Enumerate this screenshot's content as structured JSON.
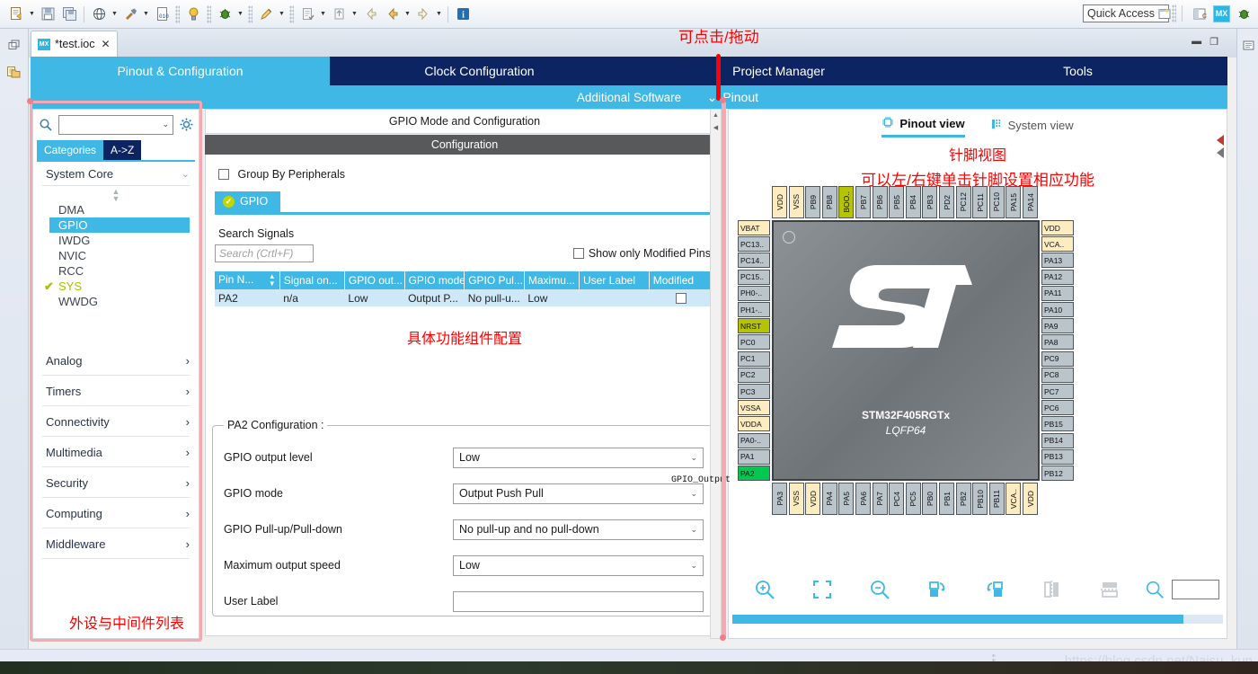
{
  "toolbar": {
    "quick_access_label": "Quick Access",
    "icons": [
      "new-file-icon",
      "save-icon",
      "save-all-icon",
      "globe-icon",
      "build-hammer-icon",
      "binary-file-icon",
      "debug-bulb-icon",
      "debug-bug-icon",
      "pen-icon",
      "marker-icon",
      "export-icon",
      "back-icon",
      "forward-icon",
      "info-icon"
    ],
    "right_icons": [
      "perspective-add-icon",
      "c-perspective-icon",
      "mx-perspective-icon",
      "debug-perspective-icon"
    ],
    "mx_badge": "MX"
  },
  "editor": {
    "tab_title": "*test.ioc",
    "tab_icon_label": "MX",
    "close_glyph": "✕"
  },
  "cube_tabs": [
    {
      "label": "Pinout & Configuration",
      "active": true
    },
    {
      "label": "Clock Configuration",
      "active": false
    },
    {
      "label": "Project Manager",
      "active": false
    },
    {
      "label": "Tools",
      "active": false
    }
  ],
  "subbar": {
    "additional_software": "Additional Software",
    "pinout": "Pinout",
    "pinout_chevron": "⌄"
  },
  "sidebar": {
    "search_placeholder": "",
    "search_value": "",
    "gear_icon": "gear-icon",
    "mode_tabs": [
      {
        "label": "Categories",
        "active": true
      },
      {
        "label": "A->Z",
        "active": false
      }
    ],
    "groups": [
      {
        "label": "System Core",
        "expanded": true,
        "items": [
          {
            "label": "DMA",
            "selected": false,
            "checked": false
          },
          {
            "label": "GPIO",
            "selected": true,
            "checked": false
          },
          {
            "label": "IWDG",
            "selected": false,
            "checked": false
          },
          {
            "label": "NVIC",
            "selected": false,
            "checked": false
          },
          {
            "label": "RCC",
            "selected": false,
            "checked": false
          },
          {
            "label": "SYS",
            "selected": false,
            "checked": true
          },
          {
            "label": "WWDG",
            "selected": false,
            "checked": false
          }
        ]
      },
      {
        "label": "Analog",
        "expanded": false,
        "items": []
      },
      {
        "label": "Timers",
        "expanded": false,
        "items": []
      },
      {
        "label": "Connectivity",
        "expanded": false,
        "items": []
      },
      {
        "label": "Multimedia",
        "expanded": false,
        "items": []
      },
      {
        "label": "Security",
        "expanded": false,
        "items": []
      },
      {
        "label": "Computing",
        "expanded": false,
        "items": []
      },
      {
        "label": "Middleware",
        "expanded": false,
        "items": []
      }
    ],
    "annotation": "外设与中间件列表"
  },
  "config": {
    "mode_title": "GPIO Mode and Configuration",
    "section_title": "Configuration",
    "group_by_peripherals": "Group By Peripherals",
    "group_by_checked": false,
    "peripheral_tab": "GPIO",
    "search_signals_label": "Search Signals",
    "search_placeholder": "Search (Crtl+F)",
    "search_value": "",
    "show_modified_label": "Show only Modified Pins",
    "show_modified_checked": false,
    "table": {
      "headers": [
        "Pin N...",
        "Signal on...",
        "GPIO out...",
        "GPIO mode",
        "GPIO Pul...",
        "Maximu...",
        "User Label",
        "Modified"
      ],
      "sort_column": 0,
      "rows": [
        {
          "pin": "PA2",
          "signal": "n/a",
          "output": "Low",
          "mode": "Output P...",
          "pull": "No pull-u...",
          "max_speed": "Low",
          "user_label": "",
          "modified": false
        }
      ]
    },
    "annotation": "具体功能组件配置",
    "pin_config": {
      "legend": "PA2 Configuration :",
      "fields": [
        {
          "label": "GPIO output level",
          "value": "Low",
          "type": "select"
        },
        {
          "label": "GPIO mode",
          "value": "Output Push Pull",
          "type": "select"
        },
        {
          "label": "GPIO Pull-up/Pull-down",
          "value": "No pull-up and no pull-down",
          "type": "select"
        },
        {
          "label": "Maximum output speed",
          "value": "Low",
          "type": "select"
        },
        {
          "label": "User Label",
          "value": "",
          "type": "text"
        }
      ]
    }
  },
  "pinout": {
    "views": [
      {
        "label": "Pinout view",
        "icon": "chip-icon",
        "active": true
      },
      {
        "label": "System view",
        "icon": "bars-icon",
        "active": false
      }
    ],
    "annotation_1": "针脚视图",
    "annotation_2": "可以左/右键单击针脚设置相应功能",
    "chip": {
      "name": "STM32F405RGTx",
      "package": "LQFP64"
    },
    "signal_label": "GPIO_Output",
    "pins_top": [
      "VDD",
      "VSS",
      "PB9",
      "PB8",
      "BOO..",
      "PB7",
      "PB6",
      "PB5",
      "PB4",
      "PB3",
      "PD2",
      "PC12",
      "PC11",
      "PC10",
      "PA15",
      "PA14"
    ],
    "pins_left": [
      "VBAT",
      "PC13..",
      "PC14..",
      "PC15..",
      "PH0-..",
      "PH1-..",
      "NRST",
      "PC0",
      "PC1",
      "PC2",
      "PC3",
      "VSSA",
      "VDDA",
      "PA0-..",
      "PA1",
      "PA2"
    ],
    "pins_right": [
      "VDD",
      "VCA..",
      "PA13",
      "PA12",
      "PA11",
      "PA10",
      "PA9",
      "PA8",
      "PC9",
      "PC8",
      "PC7",
      "PC6",
      "PB15",
      "PB14",
      "PB13",
      "PB12"
    ],
    "pins_bottom": [
      "PA3",
      "VSS",
      "VDD",
      "PA4",
      "PA5",
      "PA6",
      "PA7",
      "PC4",
      "PC5",
      "PB0",
      "PB1",
      "PB2",
      "PB10",
      "PB11",
      "VCA..",
      "VDD"
    ],
    "power_pins": [
      "VDD",
      "VSS",
      "VBAT",
      "VSSA",
      "VDDA",
      "VCA.."
    ],
    "boot_pins": [
      "BOO..",
      "NRST"
    ],
    "selected_pin": "PA2",
    "colors": {
      "power": "#fdecc0",
      "boot": "#b6c400",
      "selected": "#00c851",
      "default": "#b9c4cb",
      "accent": "#3fb8e5",
      "tab_dark": "#0c2461",
      "annotation": "#ff0000"
    },
    "toolbar_buttons": [
      {
        "name": "zoom-in-icon"
      },
      {
        "name": "fit-to-screen-icon"
      },
      {
        "name": "zoom-out-icon"
      },
      {
        "name": "rotate-right-icon"
      },
      {
        "name": "rotate-left-icon"
      },
      {
        "name": "flip-horizontal-icon"
      },
      {
        "name": "flip-vertical-icon"
      },
      {
        "name": "pin-search-icon"
      }
    ],
    "search_value": ""
  },
  "annotations": {
    "drag_hint": "可点击/拖动"
  },
  "statusbar": {
    "watermark": "https://blog.csdn.net/Naisu_kun"
  }
}
